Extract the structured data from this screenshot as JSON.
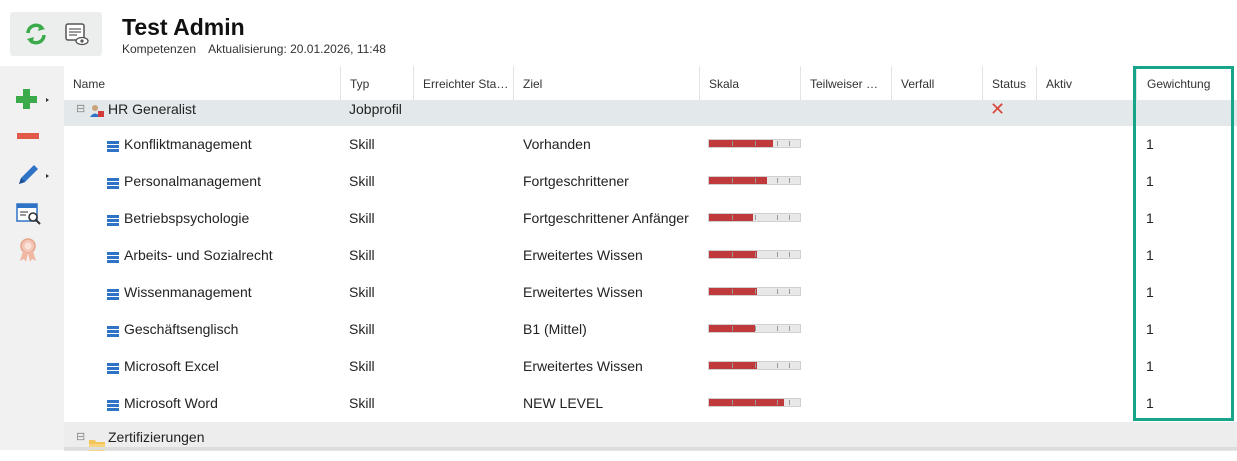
{
  "header": {
    "title": "Test Admin",
    "subtitle_module": "Kompetenzen",
    "subtitle_update": "Aktualisierung: 20.01.2026, 11:48"
  },
  "toolbar": {
    "refresh_icon": "refresh-icon",
    "preview_icon": "preview-icon"
  },
  "sidebar": {
    "buttons": [
      "add-icon",
      "remove-icon",
      "edit-icon",
      "search-details-icon",
      "certificate-icon"
    ]
  },
  "columns": [
    "Name",
    "Typ",
    "Erreichter Sta…",
    "Ziel",
    "Skala",
    "Teilweiser …",
    "Verfall",
    "Status",
    "Aktiv",
    "Gewichtung"
  ],
  "group": {
    "name": "HR Generalist",
    "type": "Jobprofil",
    "status": "✕"
  },
  "rows": [
    {
      "name": "Konfliktmanagement",
      "type": "Skill",
      "ziel": "Vorhanden",
      "level": 0.7,
      "weight": "1"
    },
    {
      "name": "Personalmanagement",
      "type": "Skill",
      "ziel": "Fortgeschrittener",
      "level": 0.64,
      "weight": "1"
    },
    {
      "name": "Betriebspsychologie",
      "type": "Skill",
      "ziel": "Fortgeschrittener Anfänger",
      "level": 0.48,
      "weight": "1"
    },
    {
      "name": "Arbeits- und Sozialrecht",
      "type": "Skill",
      "ziel": "Erweitertes Wissen",
      "level": 0.53,
      "weight": "1"
    },
    {
      "name": "Wissenmanagement",
      "type": "Skill",
      "ziel": "Erweitertes Wissen",
      "level": 0.53,
      "weight": "1"
    },
    {
      "name": "Geschäftsenglisch",
      "type": "Skill",
      "ziel": "B1 (Mittel)",
      "level": 0.51,
      "weight": "1"
    },
    {
      "name": "Microsoft Excel",
      "type": "Skill",
      "ziel": "Erweitertes Wissen",
      "level": 0.53,
      "weight": "1"
    },
    {
      "name": "Microsoft Word",
      "type": "Skill",
      "ziel": "NEW LEVEL",
      "level": 0.82,
      "weight": "1"
    }
  ],
  "group2": {
    "name": "Zertifizierungen"
  },
  "colors": {
    "accent": "#17a589",
    "bar_fill": "#c0393b",
    "group_bg": "#e3e8ea"
  }
}
